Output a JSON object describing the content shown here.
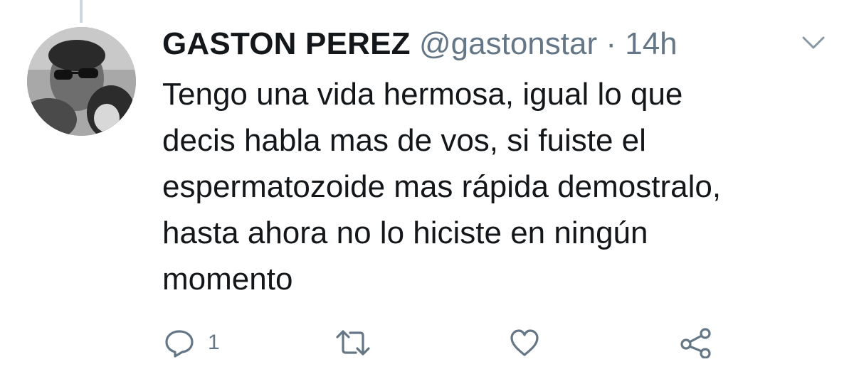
{
  "tweet": {
    "author_name": "GASTON PEREZ",
    "handle": "@gastonstar",
    "separator": "·",
    "time": "14h",
    "text_lines": [
      "Tengo una vida hermosa, igual lo que",
      "decis habla mas de vos, si fuiste el",
      "espermatozoide mas rápida demostralo,",
      "hasta ahora no lo hiciste en ningún",
      "momento"
    ]
  },
  "actions": {
    "reply_count": "1",
    "reply_icon": "reply-icon",
    "retweet_icon": "retweet-icon",
    "like_icon": "heart-icon",
    "share_icon": "share-icon"
  },
  "menu_icon": "chevron-down-icon",
  "colors": {
    "text_primary": "#14171a",
    "text_secondary": "#657786",
    "thread_line": "#ccd6dd",
    "icon": "#657786"
  }
}
